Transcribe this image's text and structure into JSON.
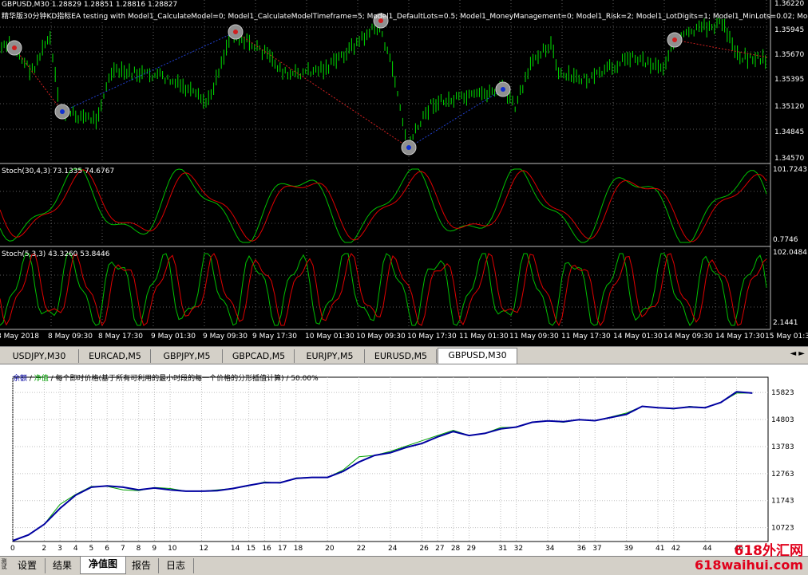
{
  "main_chart": {
    "title": "GBPUSD,M30  1.28829 1.28851 1.28816 1.28827",
    "ea_line": "精华版30分钟KD指标EA testing with Model1_CalculateModel=0; Model1_CalculateModelTimeframe=5; Model1_DefaultLots=0.5; Model1_MoneyManagement=0; Model1_Risk=2; Model1_LotDigits=1; Model1_MinLots=0.02; Model1_",
    "price_labels": [
      "1.36220",
      "1.35945",
      "1.35670",
      "1.35395",
      "1.35120",
      "1.34845",
      "1.34570"
    ]
  },
  "stoch1": {
    "label": "Stoch(30,4,3) 73.1335 74.6767",
    "max": "101.7243",
    "min": "0.7746"
  },
  "stoch2": {
    "label": "Stoch(5,3,3) 43.3260 53.8446",
    "max": "102.0484",
    "min": "2.1441"
  },
  "time_labels": [
    "8 May 2018",
    "8 May 09:30",
    "8 May 17:30",
    "9 May 01:30",
    "9 May 09:30",
    "9 May 17:30",
    "10 May 01:30",
    "10 May 09:30",
    "10 May 17:30",
    "11 May 01:30",
    "11 May 09:30",
    "11 May 17:30",
    "14 May 01:30",
    "14 May 09:30",
    "14 May 17:30",
    "15 May 01:3"
  ],
  "symbol_tabs": [
    {
      "label": "USDJPY,M30",
      "active": false
    },
    {
      "label": "EURCAD,M5",
      "active": false
    },
    {
      "label": "GBPJPY,M5",
      "active": false
    },
    {
      "label": "GBPCAD,M5",
      "active": false
    },
    {
      "label": "EURJPY,M5",
      "active": false
    },
    {
      "label": "EURUSD,M5",
      "active": false
    },
    {
      "label": "GBPUSD,M30",
      "active": true
    }
  ],
  "tab_arrows": "◄ ►",
  "tester": {
    "legend_balance": "余额",
    "legend_sep1": " / ",
    "legend_equity": "净值",
    "legend_rest": " / 每个即时价格(基于所有可利用的最小时段的每一个价格的分形插值计算) / 50.00%",
    "colors": {
      "balance": "#0000a0",
      "equity": "#00a000"
    }
  },
  "bottom_tabs": [
    {
      "label": "设置",
      "active": false
    },
    {
      "label": "结果",
      "active": false
    },
    {
      "label": "净值图",
      "active": true
    },
    {
      "label": "报告",
      "active": false
    },
    {
      "label": "日志",
      "active": false
    }
  ],
  "side_label": "测试器",
  "watermark": {
    "line1": "618外汇网",
    "line2": "618waihui.com"
  },
  "chart_data": [
    {
      "type": "line",
      "title": "",
      "xlabel": "",
      "ylabel": "",
      "x_ticks": [
        0,
        2,
        3,
        4,
        5,
        6,
        7,
        8,
        9,
        10,
        12,
        14,
        15,
        16,
        17,
        18,
        20,
        22,
        24,
        26,
        27,
        28,
        29,
        31,
        32,
        34,
        36,
        37,
        39,
        41,
        42,
        44,
        46
      ],
      "y_ticks": [
        10723,
        11743,
        12763,
        13783,
        14803,
        15823
      ],
      "xlim": [
        0,
        48
      ],
      "ylim": [
        10200,
        16400
      ],
      "series": [
        {
          "name": "净值",
          "x": [
            0,
            1,
            2,
            3,
            4,
            5,
            6,
            7,
            8,
            9,
            10,
            11,
            12,
            13,
            14,
            15,
            16,
            17,
            18,
            19,
            20,
            21,
            22,
            23,
            24,
            25,
            26,
            27,
            28,
            29,
            30,
            31,
            32,
            33,
            34,
            35,
            36,
            37,
            38,
            39,
            40,
            41,
            42,
            43,
            44,
            45,
            46,
            47
          ],
          "values": [
            10230,
            10450,
            10850,
            11600,
            11980,
            12280,
            12280,
            12150,
            12120,
            12240,
            12200,
            12100,
            12100,
            12150,
            12200,
            12300,
            12450,
            12400,
            12600,
            12620,
            12620,
            12900,
            13400,
            13450,
            13600,
            13800,
            14000,
            14200,
            14400,
            14200,
            14280,
            14500,
            14520,
            14700,
            14750,
            14700,
            14800,
            14750,
            14900,
            15050,
            15300,
            15250,
            15200,
            15300,
            15250,
            15450,
            15800,
            15800
          ]
        },
        {
          "name": "余额",
          "x": [
            0,
            1,
            2,
            3,
            4,
            5,
            6,
            7,
            8,
            9,
            10,
            11,
            12,
            13,
            14,
            15,
            16,
            17,
            18,
            19,
            20,
            21,
            22,
            23,
            24,
            25,
            26,
            27,
            28,
            29,
            30,
            31,
            32,
            33,
            34,
            35,
            36,
            37,
            38,
            39,
            40,
            41,
            42,
            43,
            44,
            45,
            46,
            47
          ],
          "values": [
            10230,
            10450,
            10850,
            11450,
            11950,
            12250,
            12300,
            12250,
            12150,
            12220,
            12150,
            12100,
            12100,
            12120,
            12200,
            12320,
            12420,
            12420,
            12580,
            12620,
            12620,
            12850,
            13200,
            13450,
            13550,
            13750,
            13900,
            14150,
            14350,
            14200,
            14280,
            14450,
            14520,
            14700,
            14750,
            14720,
            14800,
            14760,
            14880,
            15000,
            15300,
            15250,
            15220,
            15280,
            15250,
            15450,
            15850,
            15800
          ]
        }
      ]
    }
  ]
}
